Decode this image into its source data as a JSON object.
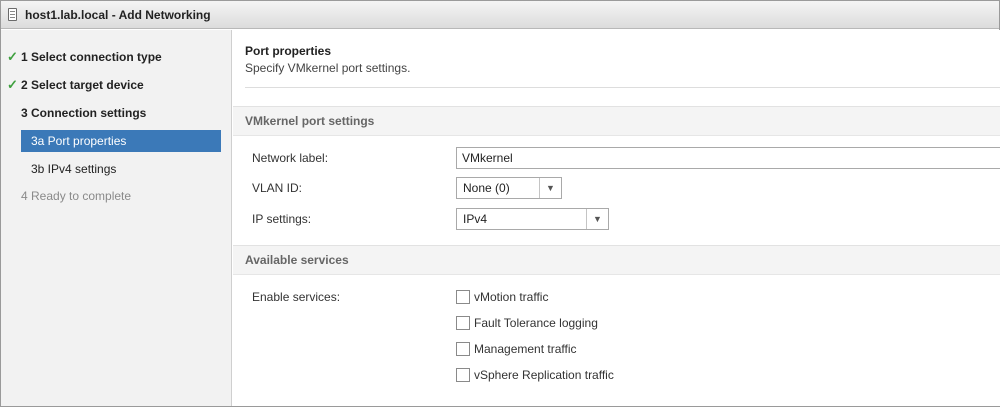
{
  "window": {
    "title": "host1.lab.local - Add Networking"
  },
  "sidebar": {
    "steps": [
      {
        "label": "1  Select connection type",
        "state": "done"
      },
      {
        "label": "2  Select target device",
        "state": "done"
      },
      {
        "label": "3  Connection settings",
        "state": "current-parent"
      },
      {
        "label": "3a  Port properties",
        "state": "active"
      },
      {
        "label": "3b  IPv4 settings",
        "state": "sub"
      },
      {
        "label": "4  Ready to complete",
        "state": "disabled"
      }
    ],
    "check_glyph": "✓"
  },
  "content": {
    "title": "Port properties",
    "subtitle": "Specify VMkernel port settings.",
    "vmkernel_section": {
      "header": "VMkernel port settings",
      "network_label_label": "Network label:",
      "network_label_value": "VMkernel",
      "vlan_label": "VLAN ID:",
      "vlan_value": "None (0)",
      "ip_label": "IP settings:",
      "ip_value": "IPv4"
    },
    "services_section": {
      "header": "Available services",
      "enable_label": "Enable services:",
      "services": [
        {
          "label": "vMotion traffic",
          "checked": false
        },
        {
          "label": "Fault Tolerance logging",
          "checked": false
        },
        {
          "label": "Management traffic",
          "checked": false
        },
        {
          "label": "vSphere Replication traffic",
          "checked": false
        }
      ]
    }
  },
  "icons": {
    "dropdown_arrow": "▼"
  },
  "colors": {
    "active_step_bg": "#3b79b8",
    "check_green": "#3fa03f"
  }
}
